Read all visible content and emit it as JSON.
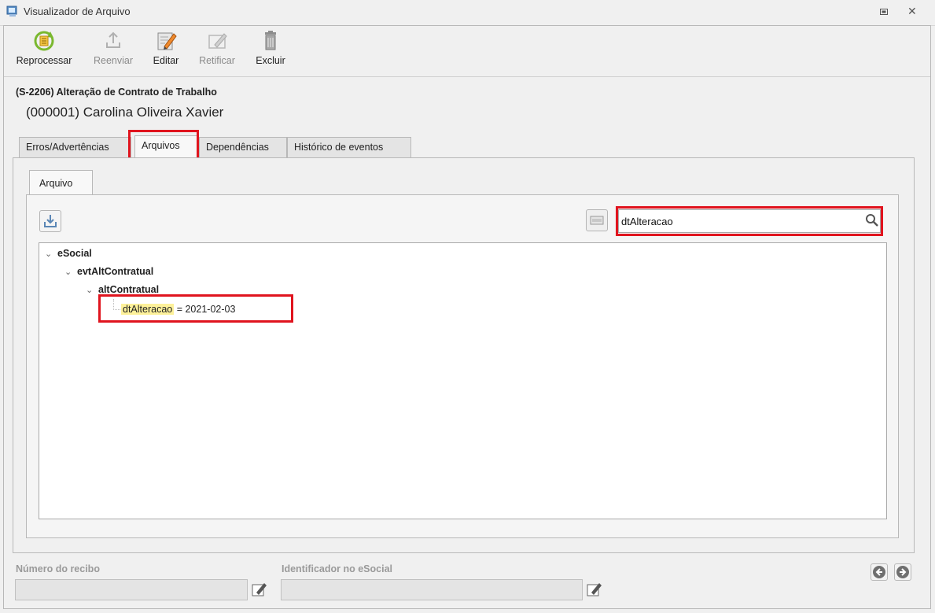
{
  "window": {
    "title": "Visualizador de Arquivo"
  },
  "toolbar": {
    "reprocess_label": "Reprocessar",
    "resend_label": "Reenviar",
    "edit_label": "Editar",
    "rectify_label": "Retificar",
    "delete_label": "Excluir"
  },
  "header": {
    "event_title": "(S-2206) Alteração de Contrato de Trabalho",
    "employee": "(000001) Carolina Oliveira Xavier"
  },
  "tabs": [
    {
      "label": "Erros/Advertências",
      "active": false
    },
    {
      "label": "Arquivos",
      "active": true
    },
    {
      "label": "Dependências",
      "active": false
    },
    {
      "label": "Histórico de eventos",
      "active": false
    }
  ],
  "subtab": {
    "label": "Arquivo"
  },
  "search": {
    "value": "dtAlteracao",
    "icon": "search-icon"
  },
  "tree": {
    "nodes": [
      {
        "label": "eSocial",
        "level": 0
      },
      {
        "label": "evtAltContratual",
        "level": 1
      },
      {
        "label": "altContratual",
        "level": 2
      }
    ],
    "leaf": {
      "key": "dtAlteracao",
      "separator": " = ",
      "value": "2021-02-03"
    }
  },
  "footer": {
    "receipt_label": "Número do recibo",
    "receipt_value": "",
    "esocial_id_label": "Identificador no eSocial",
    "esocial_id_value": ""
  },
  "colors": {
    "highlight_border": "#e0141e",
    "match_highlight": "#fdf19a"
  }
}
